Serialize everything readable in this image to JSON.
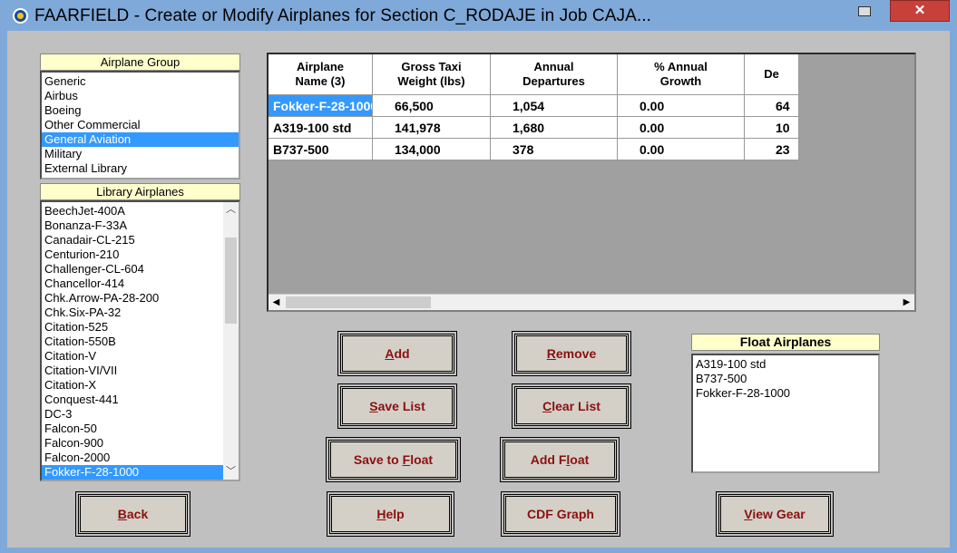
{
  "window": {
    "title": "FAARFIELD - Create or Modify Airplanes for Section C_RODAJE in Job CAJA...",
    "minimize_label": "–",
    "close_label": "✕"
  },
  "airplane_group": {
    "label": "Airplane Group",
    "items": [
      "Generic",
      "Airbus",
      "Boeing",
      "Other Commercial",
      "General Aviation",
      "Military",
      "External Library"
    ],
    "selected": "General Aviation"
  },
  "library_airplanes": {
    "label": "Library Airplanes",
    "items": [
      "BeechJet-400A",
      "Bonanza-F-33A",
      "Canadair-CL-215",
      "Centurion-210",
      "Challenger-CL-604",
      "Chancellor-414",
      "Chk.Arrow-PA-28-200",
      "Chk.Six-PA-32",
      "Citation-525",
      "Citation-550B",
      "Citation-V",
      "Citation-VI/VII",
      "Citation-X",
      "Conquest-441",
      "DC-3",
      "Falcon-50",
      "Falcon-900",
      "Falcon-2000",
      "Fokker-F-28-1000"
    ],
    "selected": "Fokker-F-28-1000"
  },
  "grid": {
    "columns": [
      "Airplane\nName (3)",
      "Gross Taxi\nWeight (lbs)",
      "Annual\nDepartures",
      "% Annual\nGrowth",
      "De"
    ],
    "rows": [
      [
        "Fokker-F-28-1000",
        "66,500",
        "1,054",
        "0.00",
        "64"
      ],
      [
        "A319-100 std",
        "141,978",
        "1,680",
        "0.00",
        "10"
      ],
      [
        "B737-500",
        "134,000",
        "378",
        "0.00",
        "23"
      ]
    ],
    "selected_row": 0
  },
  "buttons": {
    "add": {
      "u": "A",
      "rest": "dd"
    },
    "remove": {
      "u": "R",
      "rest": "emove"
    },
    "save_list": {
      "u": "S",
      "rest": "ave List"
    },
    "clear_list": {
      "u": "C",
      "rest": "lear List"
    },
    "save_to_float": {
      "pre": "Save to ",
      "u": "F",
      "rest": "loat"
    },
    "add_float": {
      "pre": "Add F",
      "u": "l",
      "rest": "oat"
    },
    "back": {
      "u": "B",
      "rest": "ack"
    },
    "help": {
      "u": "H",
      "rest": "elp"
    },
    "cdf_graph": {
      "label": "CDF Graph"
    },
    "view_gear": {
      "u": "V",
      "rest": "iew Gear"
    }
  },
  "float_airplanes": {
    "label": "Float Airplanes",
    "items": [
      "A319-100 std",
      "B737-500",
      "Fokker-F-28-1000"
    ]
  },
  "colors": {
    "selection": "#3399ff",
    "button_text": "#8b1010",
    "label_bg": "#ffffcc",
    "client_bg": "#c0c0c0",
    "close_bg": "#c7403a"
  }
}
